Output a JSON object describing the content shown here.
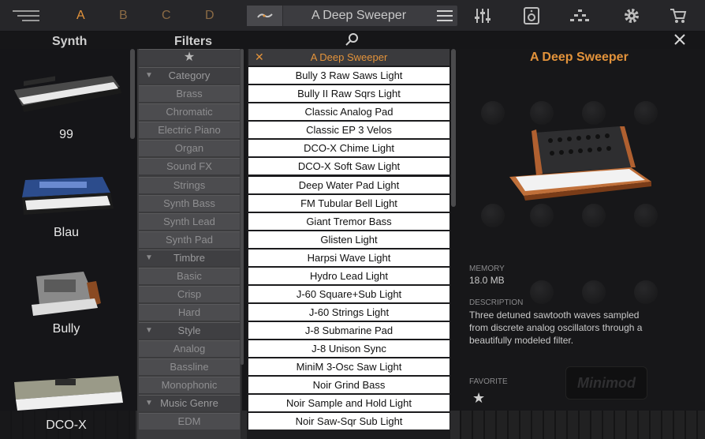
{
  "topbar": {
    "slots": [
      {
        "label": "A",
        "active": true
      },
      {
        "label": "B",
        "active": false
      },
      {
        "label": "C",
        "active": false
      },
      {
        "label": "D",
        "active": false
      }
    ],
    "preset_name": "A Deep Sweeper",
    "icons": [
      "hamburger-icon",
      "preset-glyph-icon",
      "preset-menu-icon",
      "mixer-icon",
      "device-icon",
      "hierarchy-icon",
      "gear-icon",
      "cart-icon"
    ]
  },
  "headers": {
    "synth": "Synth",
    "filters": "Filters"
  },
  "synths": [
    {
      "label": "99"
    },
    {
      "label": "Blau"
    },
    {
      "label": "Bully"
    },
    {
      "label": "DCO-X"
    }
  ],
  "filters": {
    "star": "★",
    "rows": [
      {
        "label": "Category",
        "type": "head"
      },
      {
        "label": "Brass",
        "type": "item"
      },
      {
        "label": "Chromatic",
        "type": "item"
      },
      {
        "label": "Electric Piano",
        "type": "item"
      },
      {
        "label": "Organ",
        "type": "item"
      },
      {
        "label": "Sound FX",
        "type": "item"
      },
      {
        "label": "Strings",
        "type": "item"
      },
      {
        "label": "Synth Bass",
        "type": "item"
      },
      {
        "label": "Synth Lead",
        "type": "item"
      },
      {
        "label": "Synth Pad",
        "type": "item"
      },
      {
        "label": "Timbre",
        "type": "head"
      },
      {
        "label": "Basic",
        "type": "item"
      },
      {
        "label": "Crisp",
        "type": "item"
      },
      {
        "label": "Hard",
        "type": "item"
      },
      {
        "label": "Style",
        "type": "head"
      },
      {
        "label": "Analog",
        "type": "item"
      },
      {
        "label": "Bassline",
        "type": "item"
      },
      {
        "label": "Monophonic",
        "type": "item"
      },
      {
        "label": "Music Genre",
        "type": "head"
      },
      {
        "label": "EDM",
        "type": "item"
      }
    ]
  },
  "presets": {
    "selected": "A Deep Sweeper",
    "items": [
      "Bully 3 Raw Saws Light",
      "Bully II Raw Sqrs Light",
      "Classic Analog Pad",
      "Classic EP 3 Velos",
      "DCO-X Chime Light",
      "DCO-X Soft Saw Light",
      "Deep Water Pad Light",
      "FM Tubular Bell Light",
      "Giant Tremor Bass",
      "Glisten Light",
      "Harpsi Wave Light",
      "Hydro Lead Light",
      "J-60 Square+Sub Light",
      "J-60 Strings Light",
      "J-8 Submarine Pad",
      "J-8 Unison Sync",
      "MiniM 3-Osc Saw Light",
      "Noir Grind Bass",
      "Noir Sample and Hold Light",
      "Noir Saw-Sqr Sub Light"
    ]
  },
  "detail": {
    "title": "A Deep Sweeper",
    "memory_label": "MEMORY",
    "memory_value": "18.0 MB",
    "description_label": "DESCRIPTION",
    "description": "Three detuned sawtooth waves sampled from discrete analog oscillators through a beautifully modeled filter.",
    "favorite_label": "FAVORITE",
    "favorite_star": "★",
    "logo_text": "Minimod"
  },
  "colors": {
    "accent": "#e3933b",
    "list_bg": "#ffffff",
    "panel": "#3b3b3d"
  }
}
